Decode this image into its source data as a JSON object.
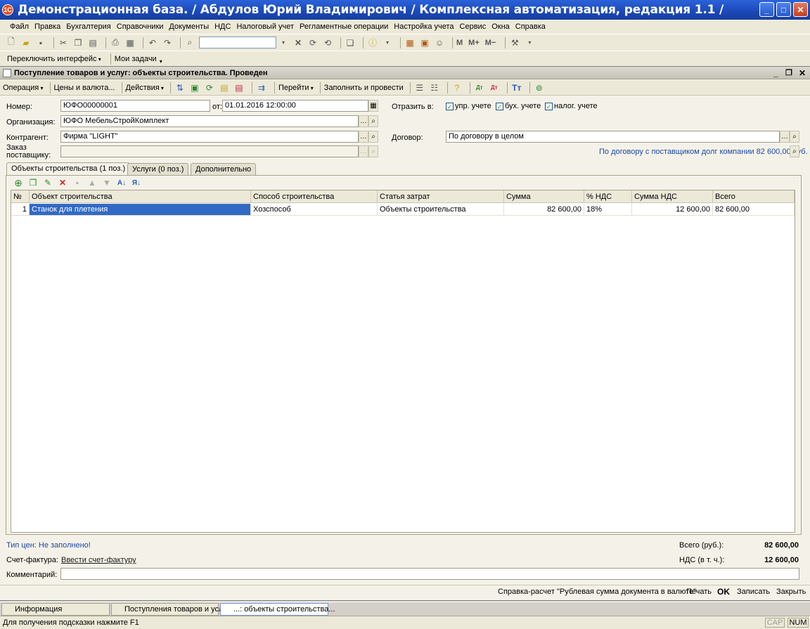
{
  "window": {
    "logo": "1С",
    "title": "Демонстрационная база. / Абдулов Юрий Владимирович / Комплексная автоматизация, редакция 1.1 /",
    "min_label": "_",
    "max_label": "□",
    "close_label": "✕"
  },
  "menu": [
    "Файл",
    "Правка",
    "Бухгалтерия",
    "Справочники",
    "Документы",
    "НДС",
    "Налоговый учет",
    "Регламентные операции",
    "Настройка учета",
    "Сервис",
    "Окна",
    "Справка"
  ],
  "toolbar1": {
    "search_value": "",
    "m_label": "M",
    "mplus_label": "M+",
    "mminus_label": "M−"
  },
  "toolbar2": {
    "switch_label": "Переключить интерфейс",
    "tasks_label": "Мои задачи"
  },
  "document": {
    "title": "Поступление товаров и услуг: объекты строительства. Проведен",
    "toolbar": [
      "Операция",
      "Цены и валюта...",
      "Действия",
      "Перейти",
      "Заполнить и провести"
    ],
    "fields": {
      "number_label": "Номер:",
      "number_value": "ЮФО00000001",
      "date_label": "от:",
      "date_value": "01.01.2016 12:00:00",
      "org_label": "Организация:",
      "org_value": "ЮФО МебельСтройКомплект",
      "contractor_label": "Контрагент:",
      "contractor_value": "Фирма \"LIGHT\"",
      "order_label_1": "Заказ",
      "order_label_2": "поставщику:",
      "order_value": "",
      "reflect_label": "Отразить в:",
      "chk_upr": "упр. учете",
      "chk_buh": "бух. учете",
      "chk_nal": "налог. учете",
      "contract_label": "Договор:",
      "contract_value": "По договору в целом",
      "debt_text": "По договору с поставщиком долг компании 82 600,00 руб."
    },
    "tabs": [
      "Объекты строительства (1 поз.)",
      "Услуги (0 поз.)",
      "Дополнительно"
    ],
    "grid": {
      "columns": [
        "№",
        "Объект строительства",
        "Способ строительства",
        "Статья затрат",
        "Сумма",
        "% НДС",
        "Сумма НДС",
        "Всего"
      ],
      "rows": [
        [
          "1",
          "Станок для плетения",
          "Хозспособ",
          "Объекты строительства",
          "82 600,00",
          "18%",
          "12 600,00",
          "82 600,00"
        ]
      ]
    },
    "footer": {
      "price_type": "Тип цен: Не заполнено!",
      "invoice_label": "Счет-фактура:",
      "invoice_link": "Ввести счет-фактуру",
      "comment_label": "Комментарий:",
      "comment_value": "",
      "total_label": "Всего (руб.):",
      "total_value": "82 600,00",
      "vat_label": "НДС (в т. ч.):",
      "vat_value": "12 600,00"
    },
    "buttons": {
      "help_calc": "Справка-расчет \"Рублевая сумма документа в валюте\"",
      "print": "Печать",
      "ok": "OK",
      "save": "Записать",
      "close": "Закрыть"
    }
  },
  "taskbar": [
    "Информация",
    "Поступления товаров и услуг",
    "...: объекты строительства..."
  ],
  "status": {
    "hint": "Для получения подсказки нажмите F1",
    "cap": "CAP",
    "num": "NUM"
  },
  "colors": {
    "title_bar": "#1b48b8",
    "selection": "#316ac5",
    "link": "#1c47a8"
  }
}
